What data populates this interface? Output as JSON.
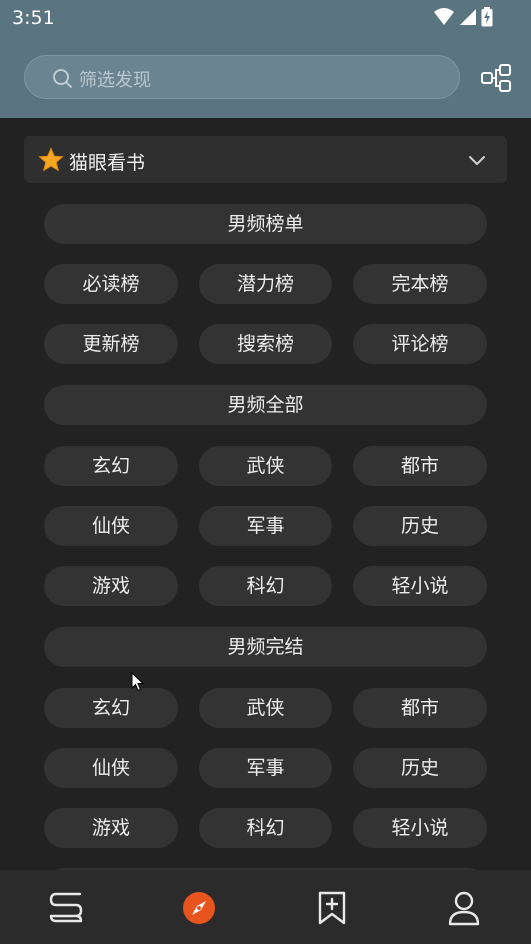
{
  "status_bar": {
    "time": "3:51"
  },
  "search": {
    "placeholder": "筛选发现"
  },
  "source": {
    "name": "猫眼看书"
  },
  "sections": {
    "male_rank": {
      "header": "男频榜单",
      "rows": [
        [
          "必读榜",
          "潜力榜",
          "完本榜"
        ],
        [
          "更新榜",
          "搜索榜",
          "评论榜"
        ]
      ]
    },
    "male_all": {
      "header": "男频全部",
      "rows": [
        [
          "玄幻",
          "武侠",
          "都市"
        ],
        [
          "仙侠",
          "军事",
          "历史"
        ],
        [
          "游戏",
          "科幻",
          "轻小说"
        ]
      ]
    },
    "male_finished": {
      "header": "男频完结",
      "rows": [
        [
          "玄幻",
          "武侠",
          "都市"
        ],
        [
          "仙侠",
          "军事",
          "历史"
        ],
        [
          "游戏",
          "科幻",
          "轻小说"
        ]
      ]
    }
  },
  "bottom_nav": {
    "items": [
      {
        "icon": "bookshelf-icon",
        "active": false
      },
      {
        "icon": "compass-icon",
        "active": true
      },
      {
        "icon": "bookmark-add-icon",
        "active": false
      },
      {
        "icon": "person-icon",
        "active": false
      }
    ]
  },
  "colors": {
    "header_bg": "#5a7480",
    "accent": "#e8541e",
    "pill_bg": "#333333",
    "page_bg": "#222222"
  }
}
